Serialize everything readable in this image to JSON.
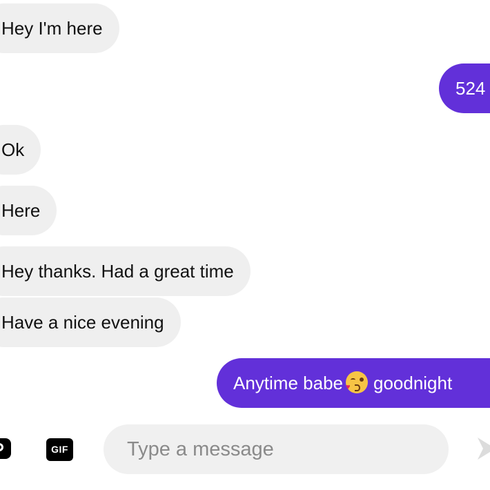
{
  "messages": [
    {
      "side": "incoming",
      "text": "Hey I'm here"
    },
    {
      "side": "outgoing",
      "text": "524"
    },
    {
      "side": "incoming",
      "text": "Ok"
    },
    {
      "side": "incoming",
      "text": "Here"
    },
    {
      "side": "incoming",
      "text": "Hey thanks. Had a great time"
    },
    {
      "side": "incoming",
      "text": "Have a nice evening"
    },
    {
      "side": "outgoing",
      "text_before": "Anytime babe",
      "emoji": "face-blowing-a-kiss",
      "text_after": "goodnight"
    }
  ],
  "composer": {
    "camera_icon": "camera-icon",
    "gif_label": "GIF",
    "placeholder": "Type a message",
    "send_icon": "send-icon"
  },
  "colors": {
    "outgoing_bubble": "#6230d9",
    "incoming_bubble": "#efefef",
    "input_background": "#f0f0f0",
    "placeholder_text": "#8a8a8a"
  }
}
